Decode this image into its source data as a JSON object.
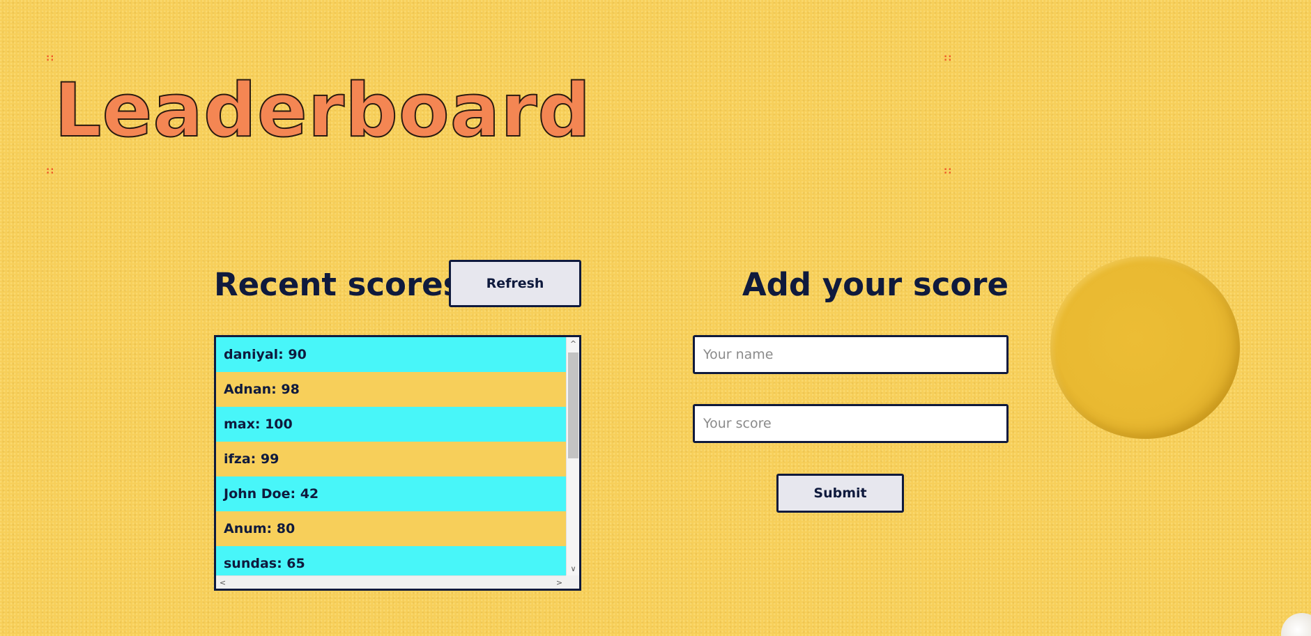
{
  "header": {
    "title": "Leaderboard",
    "corner_marks": "::"
  },
  "recent": {
    "title": "Recent scores",
    "refresh_label": "Refresh",
    "scores": [
      "daniyal: 90",
      "Adnan: 98",
      "max: 100",
      "ifza: 99",
      "John Doe: 42",
      "Anum: 80",
      "sundas: 65"
    ]
  },
  "add": {
    "title": "Add your score",
    "name_placeholder": "Your name",
    "score_placeholder": "Your score",
    "submit_label": "Submit"
  },
  "icons": {
    "scroll_up": "chevron-up-icon",
    "scroll_down": "chevron-down-icon",
    "scroll_left": "chevron-left-icon",
    "scroll_right": "chevron-right-icon"
  },
  "colors": {
    "background": "#f7cf5a",
    "title": "#f48653",
    "text": "#0f1a3d",
    "row_highlight": "#48f6f9",
    "corner_marks": "#ef5a2a"
  }
}
